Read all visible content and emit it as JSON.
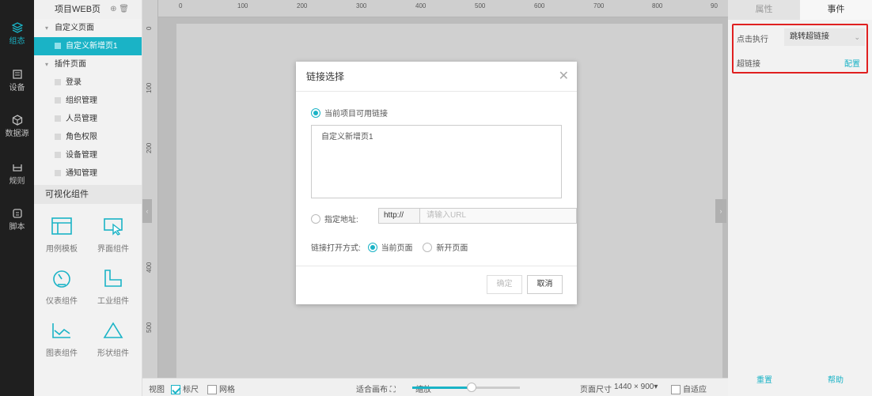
{
  "nav": {
    "items": [
      {
        "label": "组态",
        "icon": "layers-icon",
        "active": true
      },
      {
        "label": "设备",
        "icon": "device-icon",
        "active": false
      },
      {
        "label": "数据源",
        "icon": "datasource-icon",
        "active": false
      },
      {
        "label": "规则",
        "icon": "rule-icon",
        "active": false
      },
      {
        "label": "脚本",
        "icon": "script-icon",
        "active": false
      }
    ]
  },
  "tree": {
    "title": "项目WEB页",
    "group_custom": "自定义页面",
    "selected_page": "自定义新增页1",
    "group_plugin": "插件页面",
    "plugin_pages": [
      "登录",
      "组织管理",
      "人员管理",
      "角色权限",
      "设备管理",
      "通知管理"
    ],
    "components_title": "可视化组件",
    "components": [
      {
        "label": "用例模板",
        "icon": "template-icon"
      },
      {
        "label": "界面组件",
        "icon": "interface-icon"
      },
      {
        "label": "仪表组件",
        "icon": "gauge-icon"
      },
      {
        "label": "工业组件",
        "icon": "pipe-icon"
      },
      {
        "label": "图表组件",
        "icon": "chart-icon"
      },
      {
        "label": "形状组件",
        "icon": "triangle-icon"
      }
    ]
  },
  "ruler": {
    "top": [
      "0",
      "100",
      "200",
      "300",
      "400",
      "500",
      "600",
      "700",
      "800",
      "90"
    ],
    "left": [
      "0",
      "100",
      "200",
      "400",
      "500"
    ]
  },
  "dialog": {
    "title": "链接选择",
    "opt_current": "当前项目可用链接",
    "link_items": [
      "自定义新增页1"
    ],
    "opt_url": "指定地址:",
    "url_proto": "http://",
    "url_placeholder": "请输入URL",
    "open_label": "链接打开方式:",
    "open_current": "当前页面",
    "open_new": "新开页面",
    "ok": "确定",
    "cancel": "取消"
  },
  "bottombar": {
    "view": "视图",
    "ruler": "标尺",
    "grid": "网格",
    "fit": "适合画布",
    "zoom_label": "缩放",
    "zoom_fraction": 0.55,
    "page_size_label": "页面尺寸",
    "page_size": "1440 × 900",
    "auto_fit": "自适应"
  },
  "right_panel": {
    "tab_props": "属性",
    "tab_events": "事件",
    "click_label": "点击执行",
    "click_action": "跳转超链接",
    "hyperlink_label": "超链接",
    "configure": "配置",
    "reset": "重置",
    "help": "帮助"
  },
  "colors": {
    "accent": "#1ab3c6",
    "highlight": "#e02020",
    "nav_bg": "#1f1f1f"
  }
}
